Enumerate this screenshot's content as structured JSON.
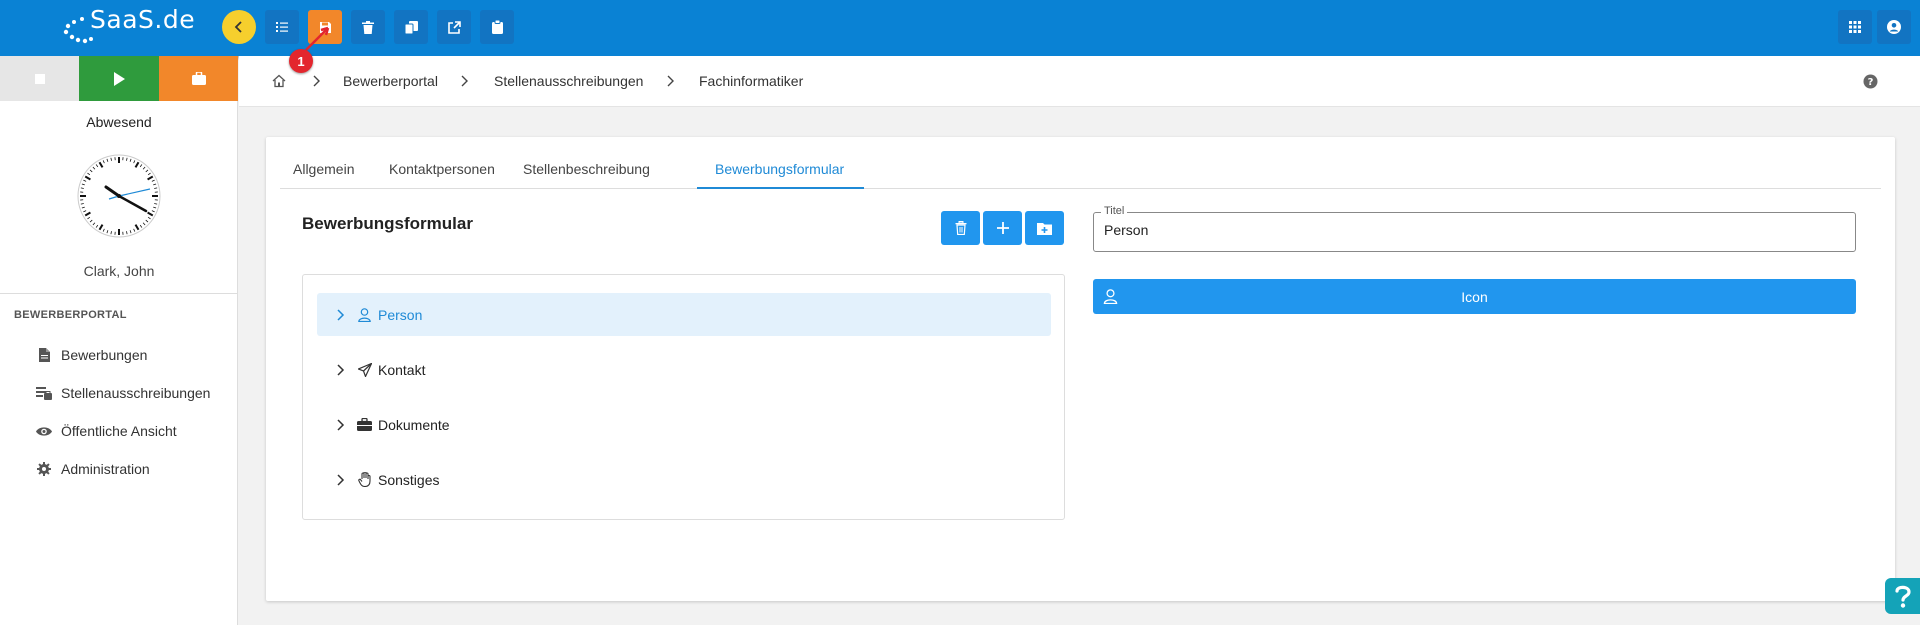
{
  "app": {
    "logo_text": "SaaS.de",
    "colors": {
      "topbar": "#0a82d4",
      "accent": "#1f8ad6",
      "button": "#2196ee",
      "save_active": "#f2872a",
      "collapse": "#f6cf2d",
      "badge": "#e3262e"
    }
  },
  "toolbar": {
    "buttons": [
      {
        "name": "list",
        "icon": "list-icon"
      },
      {
        "name": "save",
        "icon": "save-icon",
        "active": true
      },
      {
        "name": "delete",
        "icon": "trash-icon"
      },
      {
        "name": "copy",
        "icon": "copy-icon"
      },
      {
        "name": "export",
        "icon": "external-link-icon"
      },
      {
        "name": "clipboard",
        "icon": "clipboard-icon"
      }
    ],
    "right_buttons": [
      {
        "name": "apps",
        "icon": "grid-icon"
      },
      {
        "name": "profile",
        "icon": "user-circle-icon"
      }
    ],
    "badge": "1"
  },
  "sidebar": {
    "status_buttons": [
      "stop-icon",
      "play-icon",
      "briefcase-icon"
    ],
    "status_text": "Abwesend",
    "user_name": "Clark, John",
    "section_title": "BEWERBERPORTAL",
    "items": [
      {
        "label": "Bewerbungen",
        "icon": "document-icon"
      },
      {
        "label": "Stellenausschreibungen",
        "icon": "job-postings-icon"
      },
      {
        "label": "Öffentliche Ansicht",
        "icon": "eye-icon"
      },
      {
        "label": "Administration",
        "icon": "gear-icon"
      }
    ]
  },
  "breadcrumb": {
    "items": [
      "Bewerberportal",
      "Stellenausschreibungen",
      "Fachinformatiker"
    ]
  },
  "tabs": [
    {
      "label": "Allgemein"
    },
    {
      "label": "Kontaktpersonen"
    },
    {
      "label": "Stellenbeschreibung"
    },
    {
      "label": "Bewerbungsformular",
      "active": true
    }
  ],
  "form": {
    "title": "Bewerbungsformular",
    "actions": [
      "trash-icon",
      "plus-icon",
      "folder-plus-icon"
    ],
    "tree": [
      {
        "label": "Person",
        "icon": "user-icon",
        "selected": true
      },
      {
        "label": "Kontakt",
        "icon": "paper-plane-icon"
      },
      {
        "label": "Dokumente",
        "icon": "briefcase-icon"
      },
      {
        "label": "Sonstiges",
        "icon": "hand-icon"
      }
    ],
    "title_field": {
      "label": "Titel",
      "value": "Person"
    },
    "icon_button": {
      "label": "Icon",
      "icon": "user-icon"
    }
  }
}
